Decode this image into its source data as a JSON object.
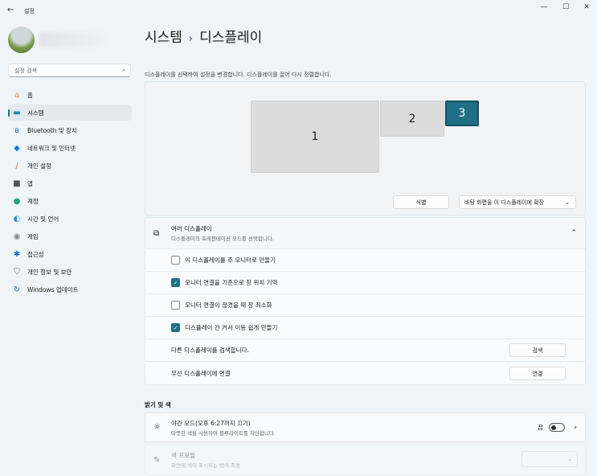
{
  "window": {
    "title": "설정",
    "min": "—",
    "max": "☐",
    "close": "✕"
  },
  "sidebar": {
    "search_placeholder": "설정 검색",
    "items": [
      {
        "label": "홈",
        "icon": "home-icon",
        "glyph": "⌂",
        "color": "#e87b2f"
      },
      {
        "label": "시스템",
        "icon": "system-icon",
        "glyph": "▬",
        "color": "#1a8bbf"
      },
      {
        "label": "Bluetooth 및 장치",
        "icon": "bluetooth-icon",
        "glyph": "ʙ",
        "color": "#1677d6"
      },
      {
        "label": "네트워크 및 인터넷",
        "icon": "wifi-icon",
        "glyph": "◆",
        "color": "#1a7fd1"
      },
      {
        "label": "개인 설정",
        "icon": "brush-icon",
        "glyph": "/",
        "color": "#d8722d"
      },
      {
        "label": "앱",
        "icon": "apps-icon",
        "glyph": "■",
        "color": "#4a5560"
      },
      {
        "label": "계정",
        "icon": "account-icon",
        "glyph": "●",
        "color": "#1aa47b"
      },
      {
        "label": "시간 및 언어",
        "icon": "globe-clock-icon",
        "glyph": "◐",
        "color": "#2a8bd0"
      },
      {
        "label": "게임",
        "icon": "gamepad-icon",
        "glyph": "◉",
        "color": "#7a8690"
      },
      {
        "label": "접근성",
        "icon": "accessibility-icon",
        "glyph": "✱",
        "color": "#1b6fc2"
      },
      {
        "label": "개인 정보 및 보안",
        "icon": "shield-icon",
        "glyph": "⛉",
        "color": "#6a747c"
      },
      {
        "label": "Windows 업데이트",
        "icon": "update-icon",
        "glyph": "↻",
        "color": "#1a78d4"
      }
    ]
  },
  "main": {
    "breadcrumb": [
      "시스템",
      "디스플레이"
    ],
    "separator": "›",
    "description": "디스플레이를 선택하여 설정을 변경합니다. 디스플레이를 끌어 다시 정렬합니다.",
    "monitors": [
      "1",
      "2",
      "3"
    ],
    "identify": "식별",
    "extend_select": "바탕 화면을 이 디스플레이에 확장",
    "multi": {
      "title": "여러 디스플레이",
      "subtitle": "디스플레이의 프레젠테이션 모드를 선택합니다.",
      "options": [
        {
          "label": "이 디스플레이를 주 모니터로 만들기",
          "checked": false
        },
        {
          "label": "모니터 연결을 기준으로 창 위치 기억",
          "checked": true
        },
        {
          "label": "모니터 연결이 끊겼을 때 창 최소화",
          "checked": false
        },
        {
          "label": "디스플레이 간 커서 이동 쉽게 만들기",
          "checked": true
        }
      ],
      "detect_label": "다른 디스플레이를 검색합니다.",
      "detect_btn": "검색",
      "wireless_label": "무선 디스플레이에 연결",
      "wireless_btn": "연결"
    },
    "brightness_heading": "밝기 및 색",
    "night": {
      "title": "야간 모드(오후 6:27까지 끄기)",
      "subtitle": "따뜻한 색을 사용하여 블루라이트를 차단합니다.",
      "state": "끔"
    },
    "profile": {
      "title": "색 프로필",
      "subtitle": "화면에 색이 표시되는 방식 조정"
    }
  },
  "accent": "#1e6f86"
}
